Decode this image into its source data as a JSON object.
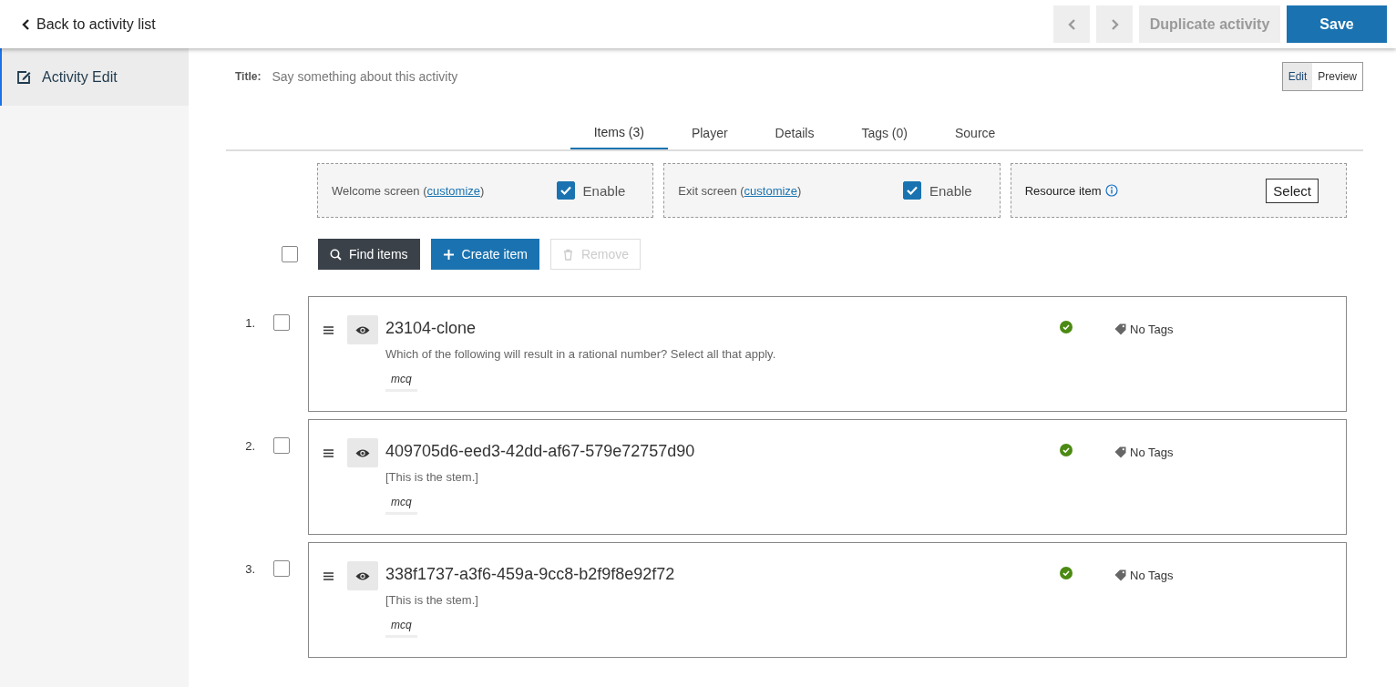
{
  "header": {
    "back_label": "Back to activity list",
    "prev_disabled": true,
    "next_disabled": true,
    "duplicate": {
      "label": "Duplicate activity",
      "disabled": true
    },
    "save": {
      "label": "Save",
      "disabled": false
    }
  },
  "sidebar": {
    "items": [
      {
        "label": "Activity Edit",
        "selected": true
      }
    ]
  },
  "title_field": {
    "label": "Title:",
    "placeholder": "Say something about this activity"
  },
  "view_toggle": [
    {
      "label": "Edit",
      "selected": true
    },
    {
      "label": "Preview",
      "selected": false
    }
  ],
  "tabs": [
    {
      "label": "Items (3)",
      "selected": true
    },
    {
      "label": "Player",
      "selected": false
    },
    {
      "label": "Details",
      "selected": false
    },
    {
      "label": "Tags (0)",
      "selected": false
    },
    {
      "label": "Source",
      "selected": false
    }
  ],
  "screens": [
    {
      "kind": "enable",
      "prefix": "Welcome screen (",
      "link": "customize",
      "suffix": ")",
      "checkbox_label": "Enable",
      "checked": true
    },
    {
      "kind": "enable",
      "prefix": "Exit screen (",
      "link": "customize",
      "suffix": ")",
      "checkbox_label": "Enable",
      "checked": true
    },
    {
      "kind": "select",
      "prefix": "Resource item",
      "button": "Select"
    }
  ],
  "toolbar": {
    "select_all_checked": false,
    "buttons": [
      {
        "kind": "find",
        "label": "Find items",
        "disabled": false
      },
      {
        "kind": "create",
        "label": "Create item",
        "disabled": false
      },
      {
        "kind": "remove",
        "label": "Remove",
        "disabled": true
      }
    ]
  },
  "items": [
    {
      "number": "1.",
      "checked": false,
      "title": "23104-clone",
      "stem": "Which of the following will result in a rational number? Select all that apply.",
      "type": "mcq",
      "valid": true,
      "tags": "No Tags"
    },
    {
      "number": "2.",
      "checked": false,
      "title": "409705d6-eed3-42dd-af67-579e72757d90",
      "stem": "[This is the stem.]",
      "type": "mcq",
      "valid": true,
      "tags": "No Tags"
    },
    {
      "number": "3.",
      "checked": false,
      "title": "338f1737-a3f6-459a-9cc8-b2f9f8e92f72",
      "stem": "[This is the stem.]",
      "type": "mcq",
      "valid": true,
      "tags": "No Tags"
    }
  ]
}
